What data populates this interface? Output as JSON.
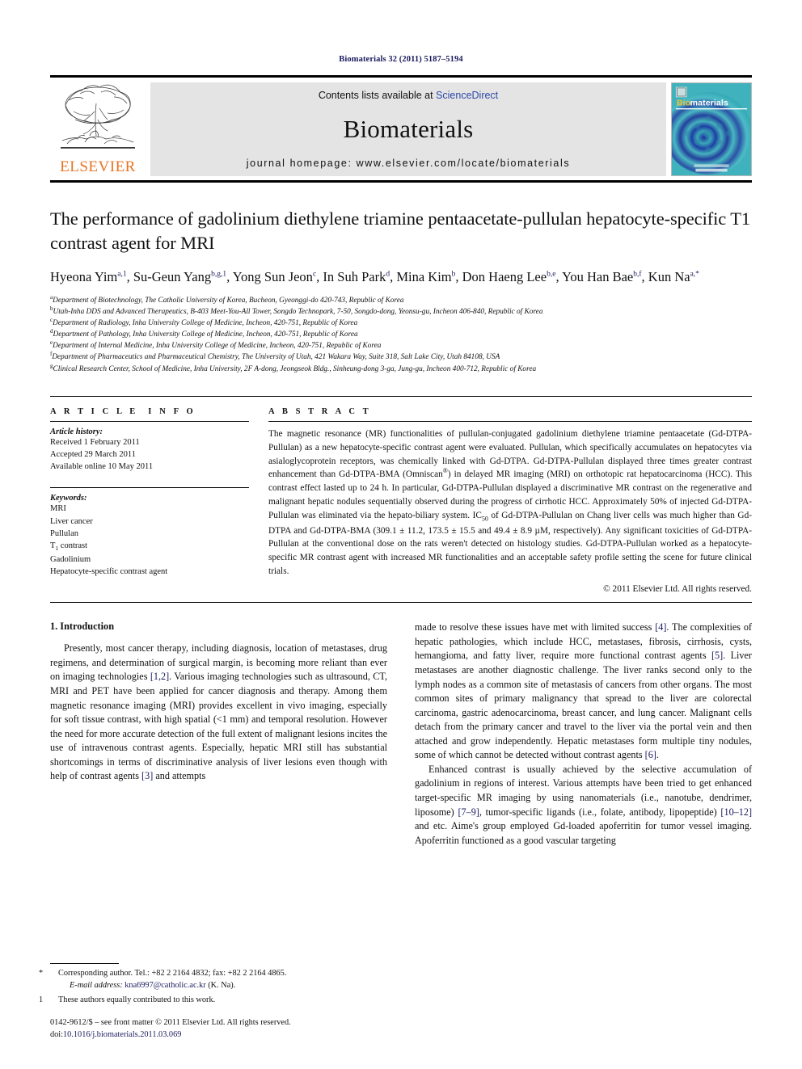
{
  "running_head": "Biomaterials 32 (2011) 5187–5194",
  "masthead": {
    "publisher_name": "ELSEVIER",
    "contents_prefix": "Contents lists available at ",
    "contents_link": "ScienceDirect",
    "journal_name": "Biomaterials",
    "homepage_label": "journal homepage: www.elsevier.com/locate/biomaterials",
    "cover_title_prefix": "Bio",
    "cover_title_suffix": "materials",
    "accent_color": "#2b48a8",
    "elsevier_orange": "#E87422"
  },
  "title": "The performance of gadolinium diethylene triamine pentaacetate-pullulan hepatocyte-specific T1 contrast agent for MRI",
  "authors": [
    {
      "name": "Hyeona Yim",
      "sup": "a,1",
      "sep": ", "
    },
    {
      "name": "Su-Geun Yang",
      "sup": "b,g,1",
      "sep": ", "
    },
    {
      "name": "Yong Sun Jeon",
      "sup": "c",
      "sep": ", "
    },
    {
      "name": "In Suh Park",
      "sup": "d",
      "sep": ", "
    },
    {
      "name": "Mina Kim",
      "sup": "b",
      "sep": ", "
    },
    {
      "name": "Don Haeng Lee",
      "sup": "b,e",
      "sep": ", "
    },
    {
      "name": "You Han Bae",
      "sup": "b,f",
      "sep": ", "
    },
    {
      "name": "Kun Na",
      "sup": "a,*",
      "sep": ""
    }
  ],
  "affiliations": [
    {
      "mark": "a",
      "text": "Department of Biotechnology, The Catholic University of Korea, Bucheon, Gyeonggi-do 420-743, Republic of Korea"
    },
    {
      "mark": "b",
      "text": "Utah-Inha DDS and Advanced Therapeutics, B-403 Meet-You-All Tower, Songdo Technopark, 7-50, Songdo-dong, Yeonsu-gu, Incheon 406-840, Republic of Korea"
    },
    {
      "mark": "c",
      "text": "Department of Radiology, Inha University College of Medicine, Incheon, 420-751, Republic of Korea"
    },
    {
      "mark": "d",
      "text": "Department of Pathology, Inha University College of Medicine, Incheon, 420-751, Republic of Korea"
    },
    {
      "mark": "e",
      "text": "Department of Internal Medicine, Inha University College of Medicine, Incheon, 420-751, Republic of Korea"
    },
    {
      "mark": "f",
      "text": "Department of Pharmaceutics and Pharmaceutical Chemistry, The University of Utah, 421 Wakara Way, Suite 318, Salt Lake City, Utah 84108, USA"
    },
    {
      "mark": "g",
      "text": "Clinical Research Center, School of Medicine, Inha University, 2F A-dong, Jeongseok Bldg., Sinheung-dong 3-ga, Jung-gu, Incheon 400-712, Republic of Korea"
    }
  ],
  "article_info": {
    "heading": "ARTICLE INFO",
    "history_label": "Article history:",
    "history": [
      "Received 1 February 2011",
      "Accepted 29 March 2011",
      "Available online 10 May 2011"
    ],
    "keywords_label": "Keywords:",
    "keywords": [
      "MRI",
      "Liver cancer",
      "Pullulan",
      "T1 contrast",
      "Gadolinium",
      "Hepatocyte-specific contrast agent"
    ],
    "t1_keyword_base": "T",
    "t1_keyword_sub": "1",
    "t1_keyword_rest": " contrast"
  },
  "abstract": {
    "heading": "ABSTRACT",
    "part1": "The magnetic resonance (MR) functionalities of pullulan-conjugated gadolinium diethylene triamine pentaacetate (Gd-DTPA-Pullulan) as a new hepatocyte-specific contrast agent were evaluated. Pullulan, which specifically accumulates on hepatocytes via asialoglycoprotein receptors, was chemically linked with Gd-DTPA. Gd-DTPA-Pullulan displayed three times greater contrast enhancement than Gd-DTPA-BMA (Omniscan",
    "reg_mark": "®",
    "part2": ") in delayed MR imaging (MRI) on orthotopic rat hepatocarcinoma (HCC). This contrast effect lasted up to 24 h. In particular, Gd-DTPA-Pullulan displayed a discriminative MR contrast on the regenerative and malignant hepatic nodules sequentially observed during the progress of cirrhotic HCC. Approximately 50% of injected Gd-DTPA-Pullulan was eliminated via the hepato-biliary system. IC",
    "ic50_sub": "50",
    "part3": " of Gd-DTPA-Pullulan on Chang liver cells was much higher than Gd-DTPA and Gd-DTPA-BMA (309.1 ± 11.2, 173.5 ± 15.5 and 49.4 ± 8.9 µM, respectively). Any significant toxicities of Gd-DTPA-Pullulan at the conventional dose on the rats weren't detected on histology studies. Gd-DTPA-Pullulan worked as a hepatocyte-specific MR contrast agent with increased MR functionalities and an acceptable safety profile setting the scene for future clinical trials.",
    "copyright": "© 2011 Elsevier Ltd. All rights reserved."
  },
  "introduction": {
    "heading": "1. Introduction",
    "left_para_1_a": "Presently, most cancer therapy, including diagnosis, location of metastases, drug regimens, and determination of surgical margin, is becoming more reliant than ever on imaging technologies ",
    "left_ref_12": "[1,2]",
    "left_para_1_b": ". Various imaging technologies such as ultrasound, CT, MRI and PET have been applied for cancer diagnosis and therapy. Among them magnetic resonance imaging (MRI) provides excellent in vivo imaging, especially for soft tissue contrast, with high spatial (<1 mm) and temporal resolution. However the need for more accurate detection of the full extent of malignant lesions incites the use of intravenous contrast agents. Especially, hepatic MRI still has substantial shortcomings in terms of discriminative analysis of liver lesions even though with help of contrast agents ",
    "left_ref_3": "[3]",
    "left_para_1_c": " and attempts",
    "right_para_1_a": "made to resolve these issues have met with limited success ",
    "right_ref_4": "[4]",
    "right_para_1_b": ". The complexities of hepatic pathologies, which include HCC, metastases, fibrosis, cirrhosis, cysts, hemangioma, and fatty liver, require more functional contrast agents ",
    "right_ref_5": "[5]",
    "right_para_1_c": ". Liver metastases are another diagnostic challenge. The liver ranks second only to the lymph nodes as a common site of metastasis of cancers from other organs. The most common sites of primary malignancy that spread to the liver are colorectal carcinoma, gastric adenocarcinoma, breast cancer, and lung cancer. Malignant cells detach from the primary cancer and travel to the liver via the portal vein and then attached and grow independently. Hepatic metastases form multiple tiny nodules, some of which cannot be detected without contrast agents ",
    "right_ref_6": "[6]",
    "right_para_1_d": ".",
    "right_para_2_a": "Enhanced contrast is usually achieved by the selective accumulation of gadolinium in regions of interest. Various attempts have been tried to get enhanced target-specific MR imaging by using nanomaterials (i.e., nanotube, dendrimer, liposome) ",
    "right_ref_79": "[7–9]",
    "right_para_2_b": ", tumor-specific ligands (i.e., folate, antibody, lipopeptide) ",
    "right_ref_1012": "[10–12]",
    "right_para_2_c": " and etc. Aime's group employed Gd-loaded apoferritin for tumor vessel imaging. Apoferritin functioned as a good vascular targeting"
  },
  "footnotes": {
    "corresponding_mark": "*",
    "corresponding_text": "Corresponding author. Tel.: +82 2 2164 4832; fax: +82 2 2164 4865.",
    "email_label": "E-mail address:",
    "email": "kna6997@catholic.ac.kr",
    "email_suffix": "(K. Na).",
    "equal_mark": "1",
    "equal_text": "These authors equally contributed to this work.",
    "issn_line": "0142-9612/$ – see front matter © 2011 Elsevier Ltd. All rights reserved.",
    "doi_label": "doi:",
    "doi_value": "10.1016/j.biomaterials.2011.03.069"
  }
}
